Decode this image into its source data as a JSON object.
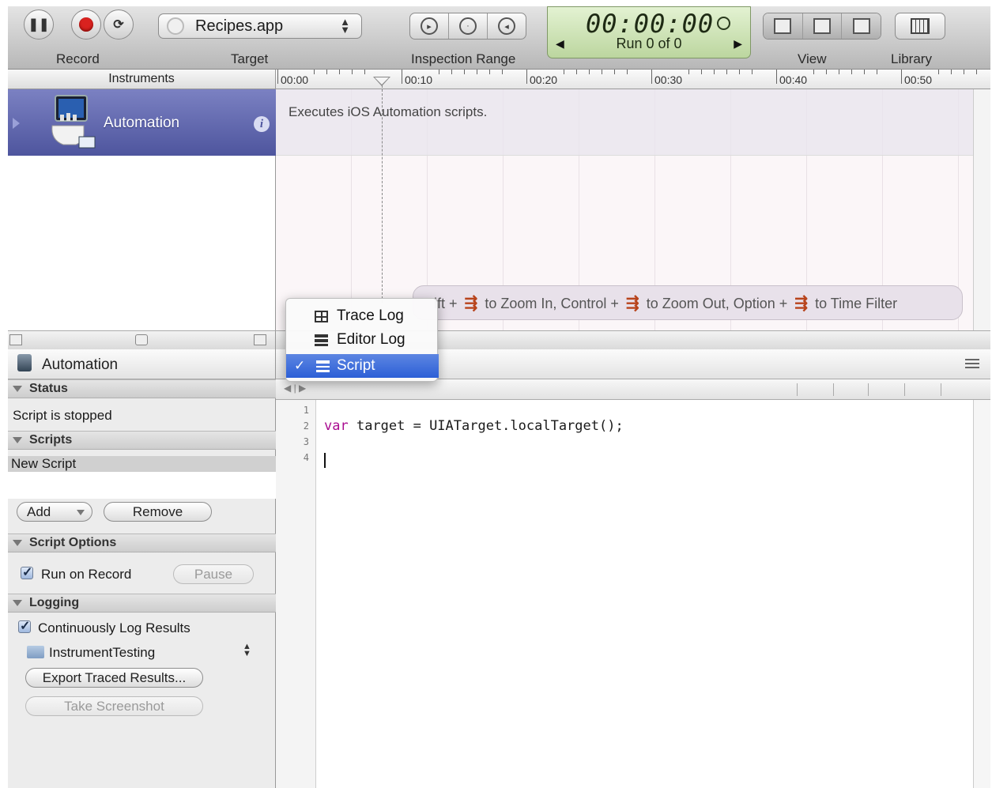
{
  "toolbar": {
    "record_label": "Record",
    "target_label": "Target",
    "target_value": "Recipes.app",
    "inspection_range_label": "Inspection Range",
    "timer": "00:00:00",
    "run_text": "Run 0 of 0",
    "view_label": "View",
    "library_label": "Library"
  },
  "instruments_header": "Instruments",
  "ruler_ticks": [
    "00:00",
    "00:10",
    "00:20",
    "00:30",
    "00:40",
    "00:50"
  ],
  "instrument": {
    "name": "Automation",
    "description": "Executes iOS Automation scripts."
  },
  "hint": {
    "part1": "ift +",
    "part2": "to Zoom In, Control +",
    "part3": "to Zoom Out, Option +",
    "part4": "to Time Filter"
  },
  "detail": {
    "title": "Automation",
    "status_section": "Status",
    "status_text": "Script is stopped",
    "scripts_section": "Scripts",
    "script_name": "New Script",
    "add_button": "Add",
    "remove_button": "Remove",
    "script_options_section": "Script Options",
    "run_on_record": "Run on Record",
    "pause_button": "Pause",
    "logging_section": "Logging",
    "continuously_log": "Continuously Log Results",
    "folder": "InstrumentTesting",
    "export_button": "Export Traced Results...",
    "screenshot_button": "Take Screenshot"
  },
  "popup_menu": {
    "items": [
      {
        "label": "Trace Log",
        "icon": "grid-icon"
      },
      {
        "label": "Editor Log",
        "icon": "editor-log-icon"
      },
      {
        "label": "Script",
        "icon": "script-icon",
        "selected": true
      }
    ],
    "check": "✓"
  },
  "editor": {
    "line_numbers": [
      "1",
      "2",
      "3",
      "4"
    ],
    "keyword": "var",
    "code_rest": " target = UIATarget.localTarget();"
  },
  "colors": {
    "selection_blue": "#2c5fd6",
    "instrument_row": "#5a61a8",
    "record_red": "#d9221f",
    "lcd_green": "#cde4b4"
  }
}
